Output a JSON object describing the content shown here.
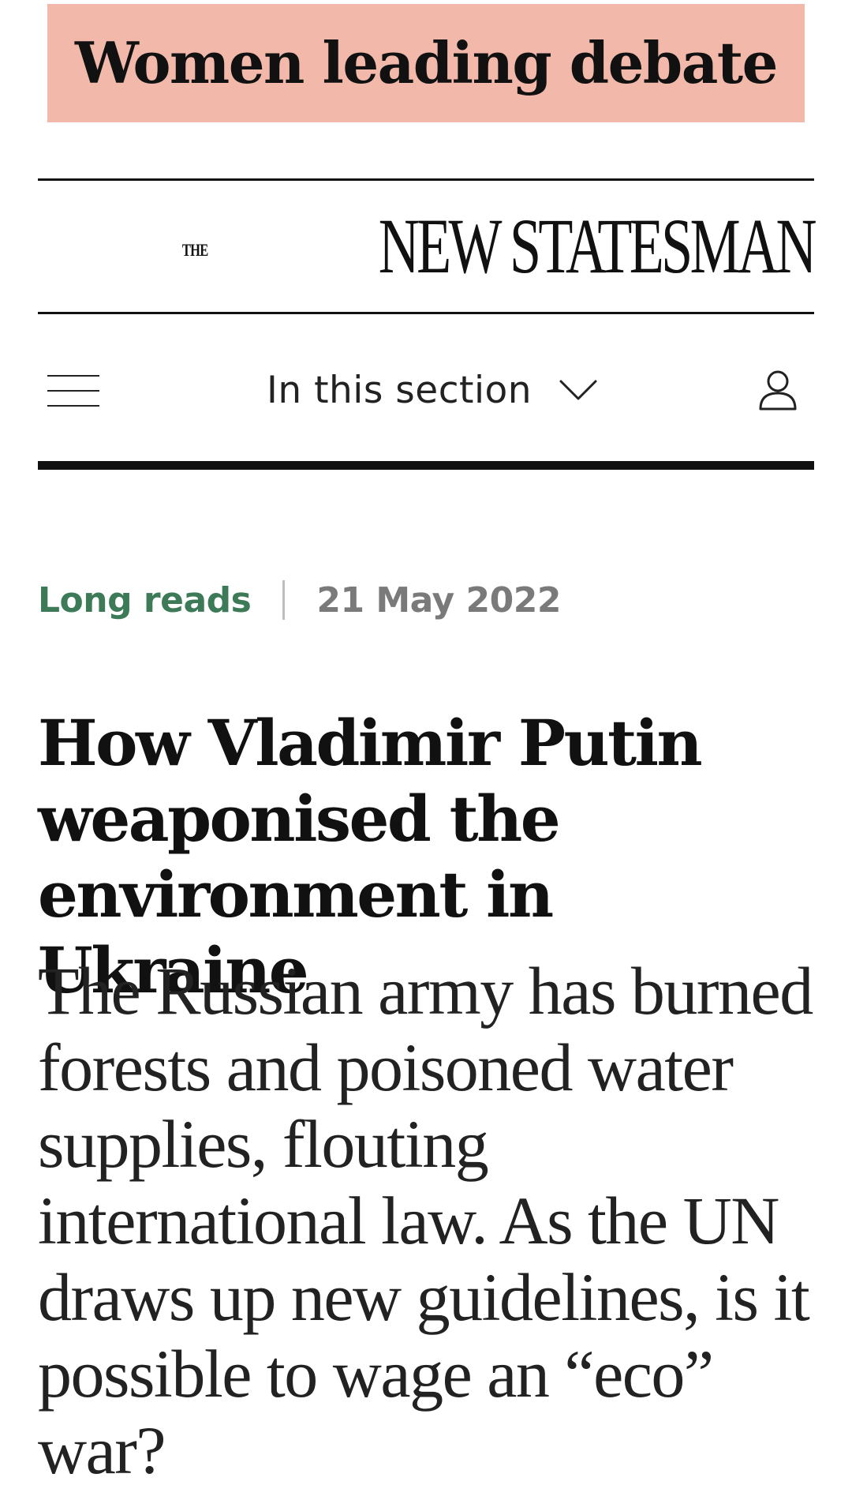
{
  "ad_banner": {
    "text": "Women leading debate"
  },
  "masthead": {
    "the": "THE",
    "name": "NEW STATESMAN"
  },
  "nav": {
    "menu_icon": "hamburger-menu-icon",
    "section_label": "In this section",
    "chevron_icon": "chevron-down-icon",
    "user_icon": "user-account-icon"
  },
  "article": {
    "category": "Long reads",
    "date": "21 May 2022",
    "headline": "How Vladimir Putin weaponised the environment in Ukraine",
    "standfirst": "The Russian army has burned forests and poisoned water supplies, flouting international law. As the UN draws up new guidelines, is it possible to wage an “eco” war?"
  },
  "colors": {
    "ad_background": "#f2b9ab",
    "category_green": "#3d7a57",
    "date_gray": "#7a7a7a",
    "rule_black": "#111111"
  }
}
